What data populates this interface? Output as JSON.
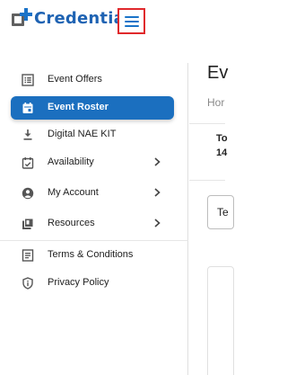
{
  "brand": {
    "logo_text": "Credentia",
    "accent": "#1b6fbf",
    "menu_highlight": "#e0292c"
  },
  "header": {
    "menu_icon": "hamburger-menu-icon"
  },
  "sidebar": {
    "items": [
      {
        "label": "Event Offers",
        "icon": "list-icon",
        "active": false,
        "has_chevron": false
      },
      {
        "label": "Event Roster",
        "icon": "calendar-icon",
        "active": true,
        "has_chevron": false
      },
      {
        "label": "Digital NAE KIT",
        "icon": "download-icon",
        "active": false,
        "has_chevron": false
      },
      {
        "label": "Availability",
        "icon": "calendar-check-icon",
        "active": false,
        "has_chevron": true
      },
      {
        "label": "My Account",
        "icon": "account-circle-icon",
        "active": false,
        "has_chevron": true
      },
      {
        "label": "Resources",
        "icon": "library-icon",
        "active": false,
        "has_chevron": true
      },
      {
        "label": "Terms & Conditions",
        "icon": "document-icon",
        "active": false,
        "has_chevron": false
      },
      {
        "label": "Privacy Policy",
        "icon": "shield-icon",
        "active": false,
        "has_chevron": false
      }
    ]
  },
  "main": {
    "heading": "Ev",
    "breadcrumb": "Hor",
    "line1": "To",
    "line2": "14",
    "input_text": "Te"
  }
}
